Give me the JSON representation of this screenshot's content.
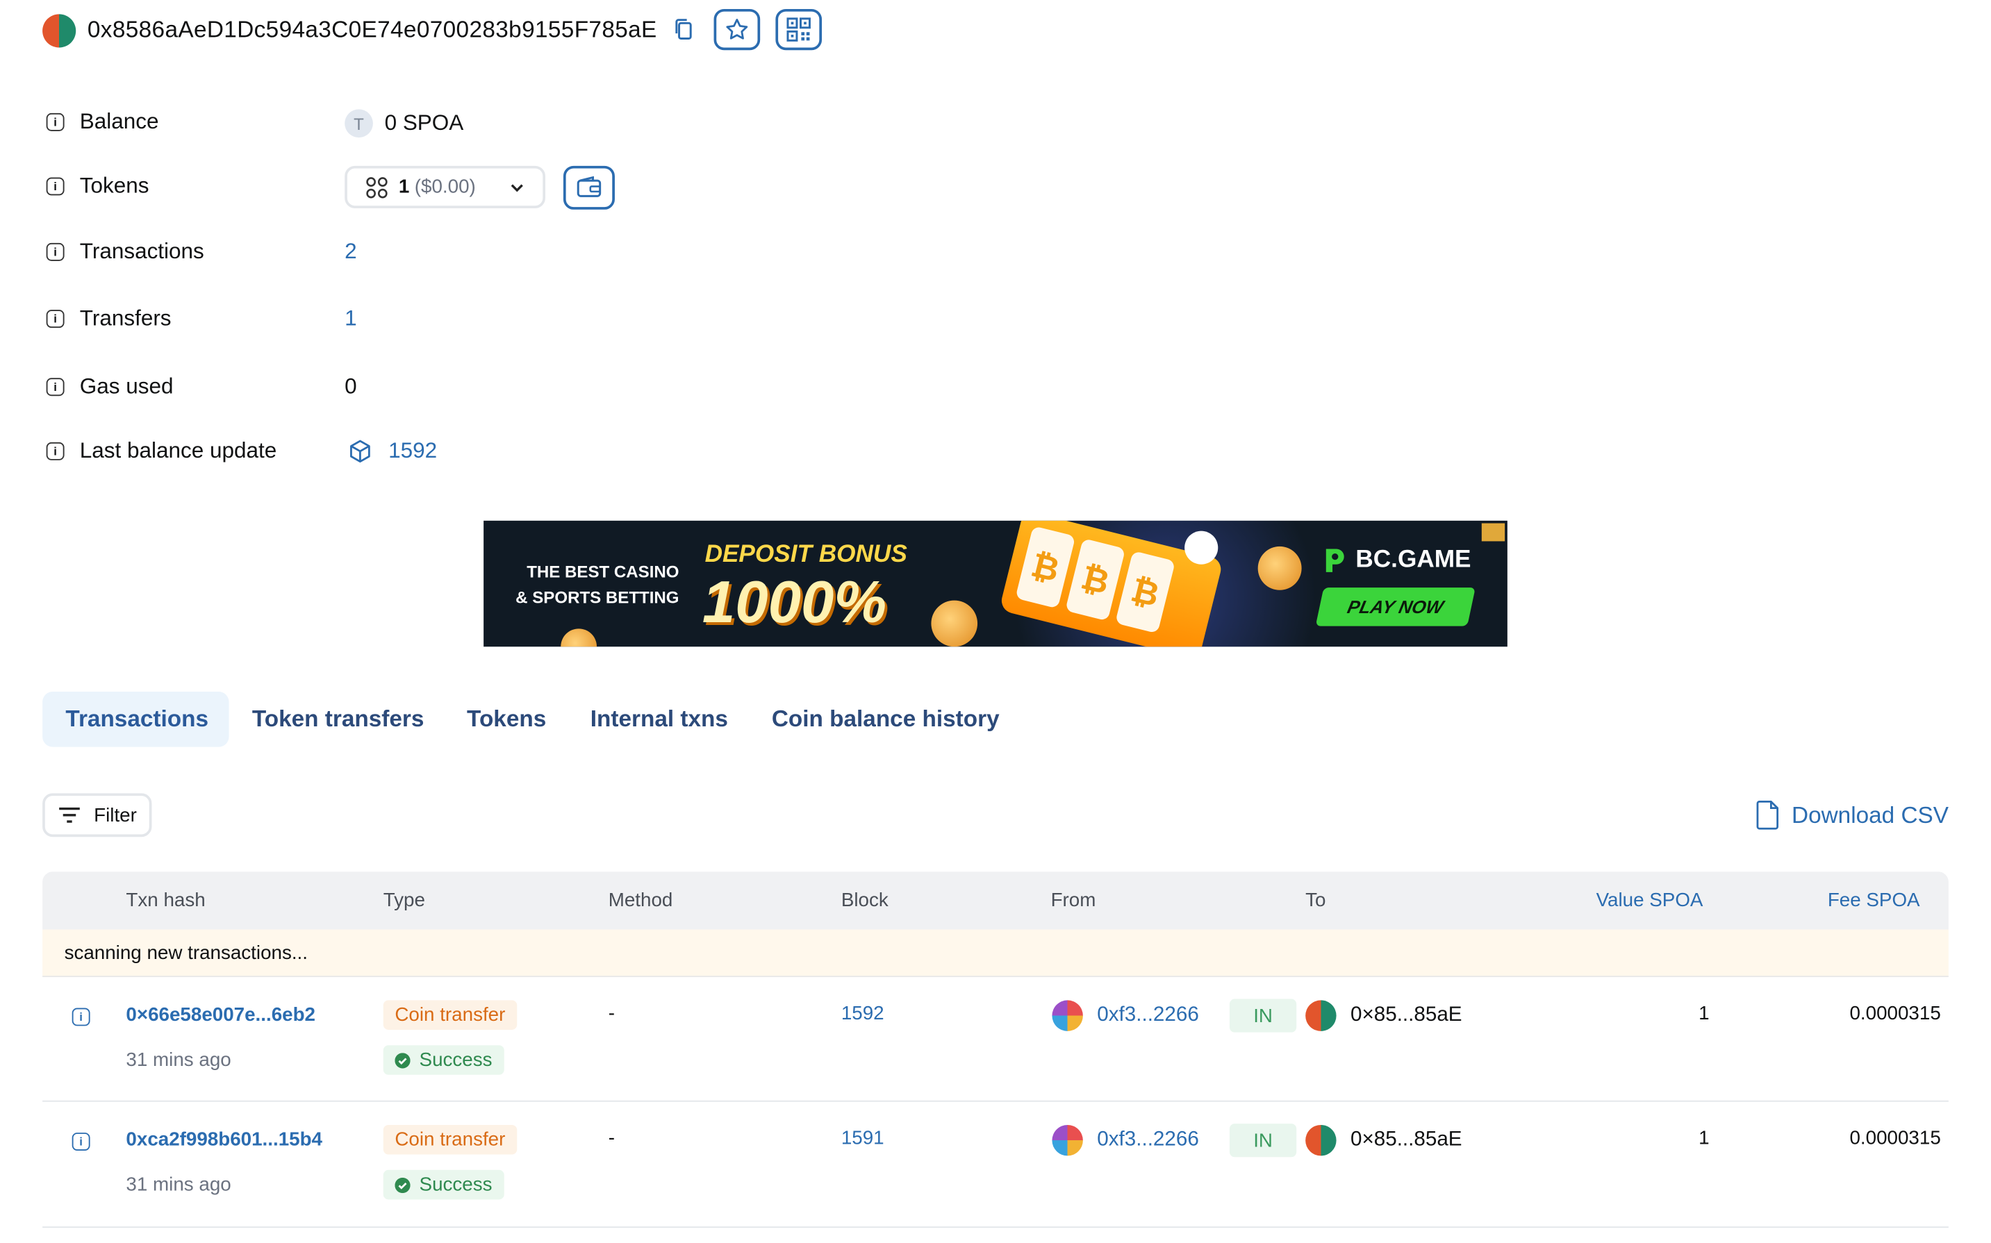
{
  "header": {
    "address": "0x8586aAeD1Dc594a3C0E74e0700283b9155F785aE"
  },
  "details": {
    "balance": {
      "label": "Balance",
      "token_letter": "T",
      "value": "0 SPOA"
    },
    "tokens": {
      "label": "Tokens",
      "count": "1",
      "usd": "($0.00)"
    },
    "transactions": {
      "label": "Transactions",
      "value": "2"
    },
    "transfers": {
      "label": "Transfers",
      "value": "1"
    },
    "gas_used": {
      "label": "Gas used",
      "value": "0"
    },
    "last_balance_update": {
      "label": "Last balance update",
      "value": "1592"
    }
  },
  "banner": {
    "left_line1": "THE BEST CASINO",
    "left_line2": "& SPORTS BETTING",
    "headline": "DEPOSIT BONUS",
    "percent": "1000%",
    "brand": "BC.GAME",
    "cta": "PLAY NOW",
    "reel_symbol": "₿"
  },
  "tabs": [
    {
      "label": "Transactions",
      "active": true
    },
    {
      "label": "Token transfers"
    },
    {
      "label": "Tokens"
    },
    {
      "label": "Internal txns"
    },
    {
      "label": "Coin balance history"
    }
  ],
  "toolbar": {
    "filter_label": "Filter",
    "download_label": "Download CSV"
  },
  "table": {
    "headers": {
      "hash": "Txn hash",
      "type": "Type",
      "method": "Method",
      "block": "Block",
      "from": "From",
      "to": "To",
      "value": "Value SPOA",
      "fee": "Fee SPOA"
    },
    "scanning": "scanning new transactions...",
    "rows": [
      {
        "hash": "0×66e58e007e...6eb2",
        "age": "31 mins ago",
        "type": "Coin transfer",
        "status": "Success",
        "method": "-",
        "block": "1592",
        "from": "0xf3...2266",
        "direction": "IN",
        "to": "0×85...85aE",
        "value": "1",
        "fee": "0.0000315"
      },
      {
        "hash": "0xca2f998b601...15b4",
        "age": "31 mins ago",
        "type": "Coin transfer",
        "status": "Success",
        "method": "-",
        "block": "1591",
        "from": "0xf3...2266",
        "direction": "IN",
        "to": "0×85...85aE",
        "value": "1",
        "fee": "0.0000315"
      }
    ]
  },
  "colors": {
    "link": "#2b6cb0",
    "active_tab_bg": "#ebf4fc",
    "success": "#2f8a4f",
    "coin_transfer": "#d96b15",
    "scanning_bg": "#fff8ec"
  }
}
